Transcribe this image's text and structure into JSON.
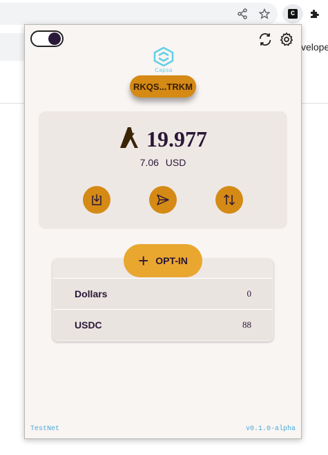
{
  "browser": {
    "bg_text": "veloper",
    "icons": [
      "share-icon",
      "star-icon",
      "extension-c-icon",
      "puzzle-icon"
    ],
    "ext_label": "C"
  },
  "wallet": {
    "brand": "Capsa",
    "address": "RKQS...TRKM",
    "balance": {
      "algo": "19.977",
      "usd_value": "7.06",
      "usd_label": "USD"
    },
    "actions": [
      {
        "name": "receive",
        "icon": "download-icon"
      },
      {
        "name": "send",
        "icon": "send-icon"
      },
      {
        "name": "swap",
        "icon": "swap-icon"
      }
    ],
    "optin_label": "OPT-IN",
    "assets": [
      {
        "name": "Dollars",
        "amount": "0"
      },
      {
        "name": "USDC",
        "amount": "88"
      }
    ],
    "network": "TestNet",
    "version": "v0.1.0-alpha",
    "colors": {
      "accent": "#d48a14",
      "optin": "#e9a730",
      "text": "#2a1636",
      "footer": "#4aa8d8"
    }
  }
}
